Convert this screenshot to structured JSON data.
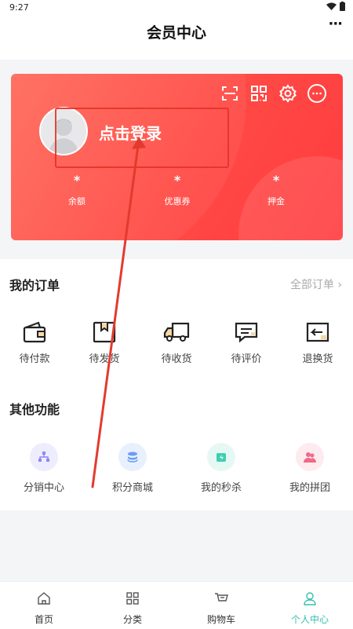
{
  "status_bar": {
    "time": "9:27"
  },
  "header": {
    "title": "会员中心",
    "more": "···"
  },
  "card": {
    "login_label": "点击登录",
    "stats": [
      {
        "value": "*",
        "label": "余额"
      },
      {
        "value": "*",
        "label": "优惠券"
      },
      {
        "value": "*",
        "label": "押金"
      }
    ],
    "icons": [
      "scan-icon",
      "qrcode-icon",
      "settings-icon",
      "message-icon"
    ]
  },
  "orders": {
    "title": "我的订单",
    "all_label": "全部订单",
    "items": [
      {
        "label": "待付款",
        "icon": "wallet-icon"
      },
      {
        "label": "待发货",
        "icon": "box-icon"
      },
      {
        "label": "待收货",
        "icon": "truck-icon"
      },
      {
        "label": "待评价",
        "icon": "comment-icon"
      },
      {
        "label": "退换货",
        "icon": "return-icon"
      }
    ]
  },
  "functions": {
    "title": "其他功能",
    "items": [
      {
        "label": "分销中心",
        "icon": "distribution-icon",
        "color": "#8f86f5"
      },
      {
        "label": "积分商城",
        "icon": "points-icon",
        "color": "#6a9cf5"
      },
      {
        "label": "我的秒杀",
        "icon": "seckill-icon",
        "color": "#3ecfb0"
      },
      {
        "label": "我的拼团",
        "icon": "group-icon",
        "color": "#f06a88"
      }
    ]
  },
  "tabbar": {
    "items": [
      {
        "label": "首页",
        "icon": "home-icon"
      },
      {
        "label": "分类",
        "icon": "category-icon"
      },
      {
        "label": "购物车",
        "icon": "cart-icon"
      },
      {
        "label": "个人中心",
        "icon": "profile-icon"
      }
    ],
    "active_color": "#33c0b0"
  }
}
